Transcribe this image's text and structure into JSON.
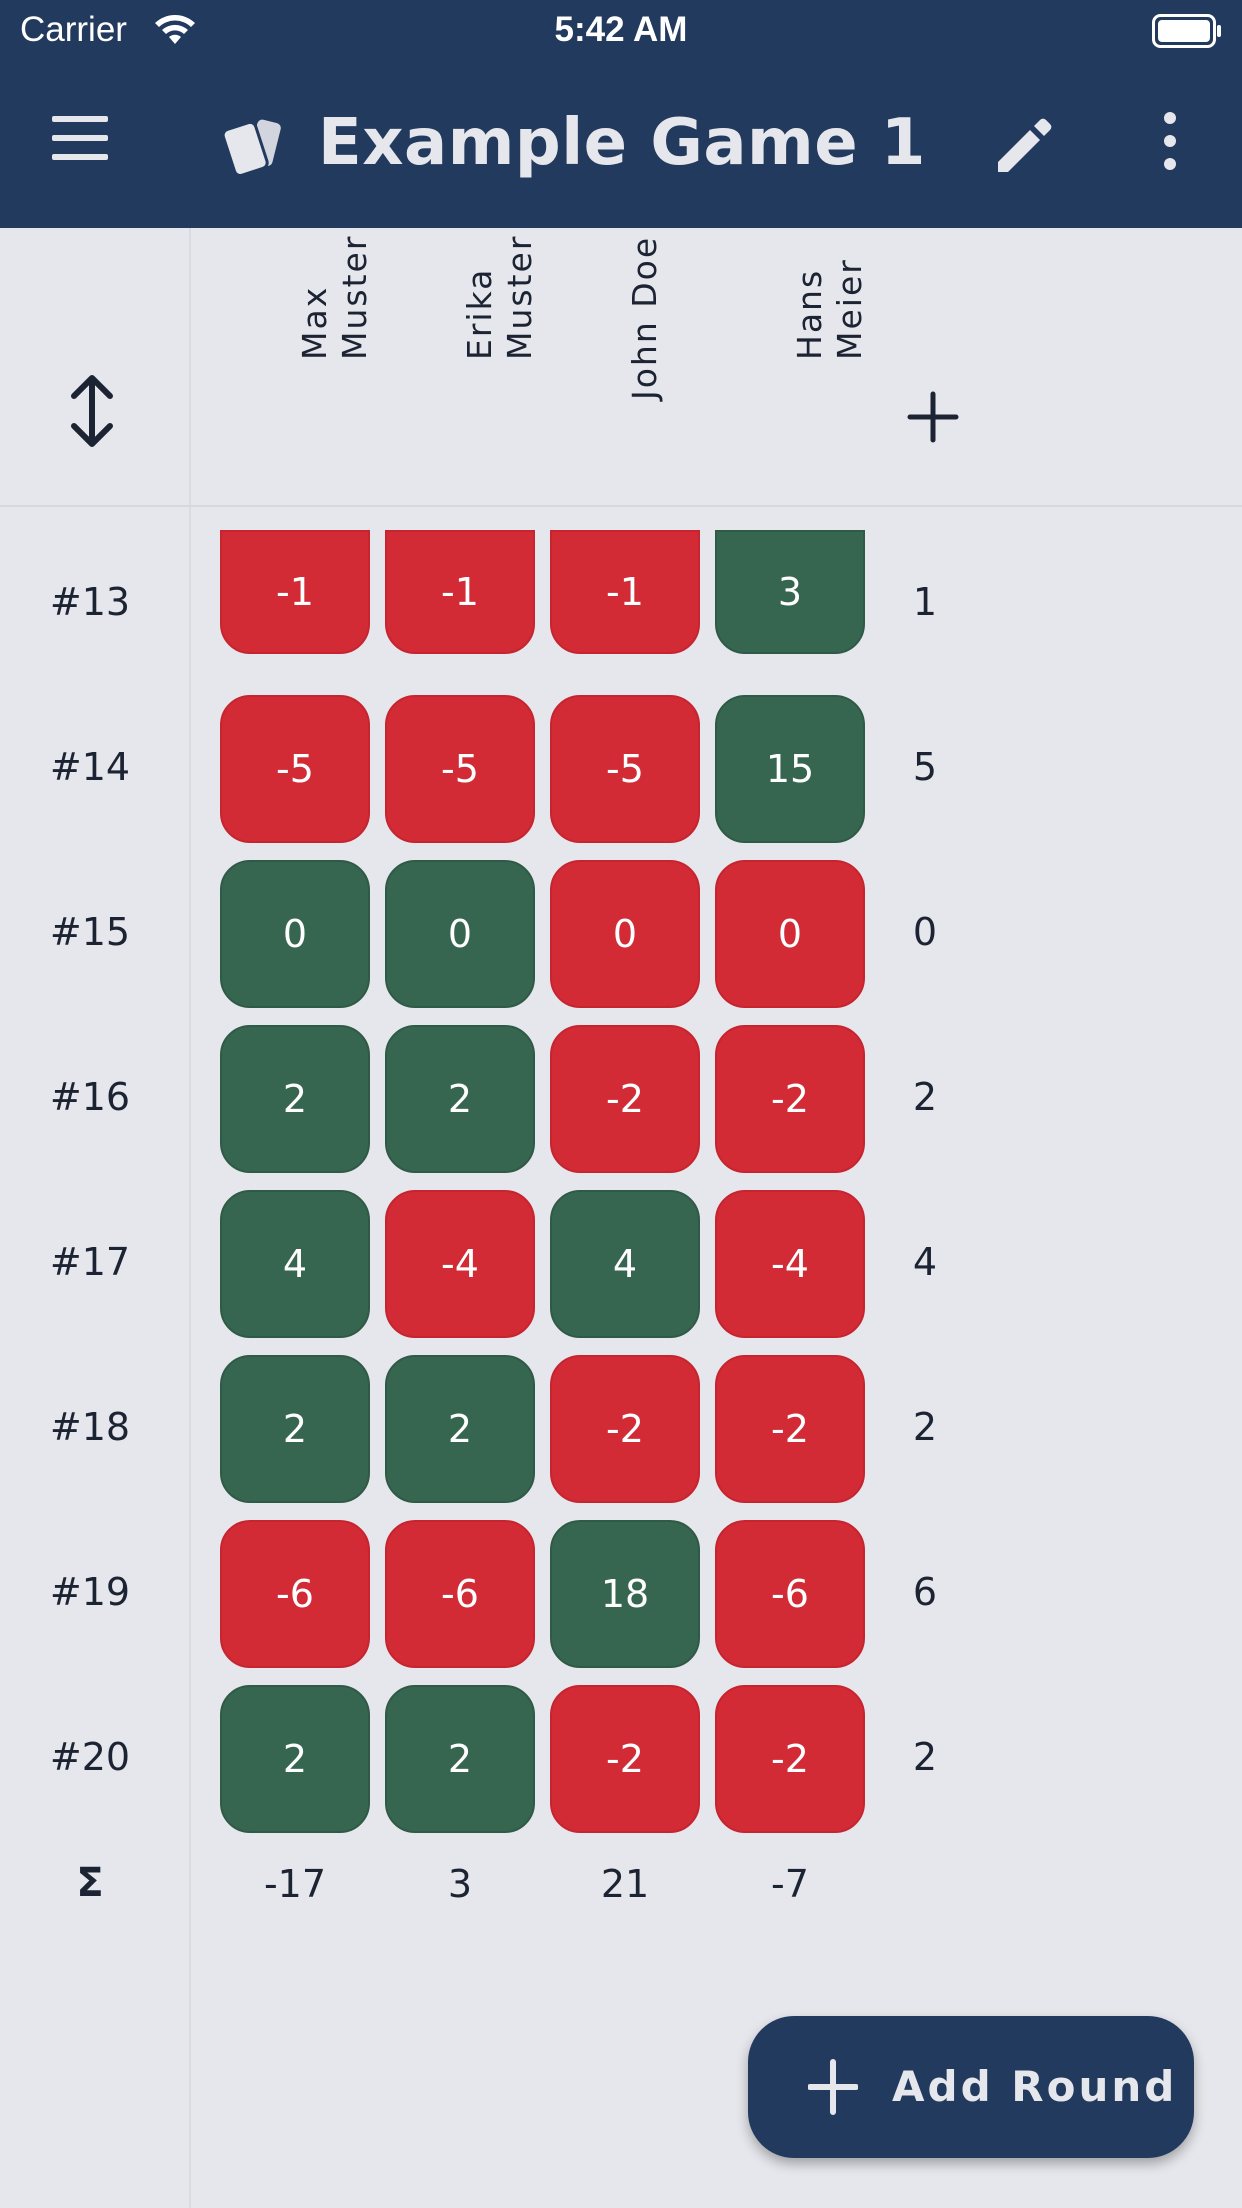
{
  "status_bar": {
    "carrier": "Carrier",
    "time": "5:42 AM"
  },
  "app_bar": {
    "title": "Example Game 1",
    "icons": [
      "menu-icon",
      "cards-icon",
      "edit-icon",
      "more-vertical-icon"
    ]
  },
  "players": [
    "Max\nMuster",
    "Erika\nMuster",
    "John Doe",
    "Hans\nMeier"
  ],
  "rounds": [
    {
      "label": "#13",
      "scores": [
        "-1",
        "-1",
        "-1",
        "3"
      ],
      "result": [
        "loss",
        "loss",
        "loss",
        "win"
      ],
      "value": "1"
    },
    {
      "label": "#14",
      "scores": [
        "-5",
        "-5",
        "-5",
        "15"
      ],
      "result": [
        "loss",
        "loss",
        "loss",
        "win"
      ],
      "value": "5"
    },
    {
      "label": "#15",
      "scores": [
        "0",
        "0",
        "0",
        "0"
      ],
      "result": [
        "win",
        "win",
        "loss",
        "loss"
      ],
      "value": "0"
    },
    {
      "label": "#16",
      "scores": [
        "2",
        "2",
        "-2",
        "-2"
      ],
      "result": [
        "win",
        "win",
        "loss",
        "loss"
      ],
      "value": "2"
    },
    {
      "label": "#17",
      "scores": [
        "4",
        "-4",
        "4",
        "-4"
      ],
      "result": [
        "win",
        "loss",
        "win",
        "loss"
      ],
      "value": "4"
    },
    {
      "label": "#18",
      "scores": [
        "2",
        "2",
        "-2",
        "-2"
      ],
      "result": [
        "win",
        "win",
        "loss",
        "loss"
      ],
      "value": "2"
    },
    {
      "label": "#19",
      "scores": [
        "-6",
        "-6",
        "18",
        "-6"
      ],
      "result": [
        "loss",
        "loss",
        "win",
        "loss"
      ],
      "value": "6"
    },
    {
      "label": "#20",
      "scores": [
        "2",
        "2",
        "-2",
        "-2"
      ],
      "result": [
        "win",
        "win",
        "loss",
        "loss"
      ],
      "value": "2"
    }
  ],
  "totals": {
    "label": "Σ",
    "values": [
      "-17",
      "3",
      "21",
      "-7"
    ]
  },
  "fab": {
    "label": "Add Round"
  },
  "colors": {
    "primary": "#223a5e",
    "background": "#e6e7ec",
    "win": "#376650",
    "loss": "#d22b36"
  }
}
